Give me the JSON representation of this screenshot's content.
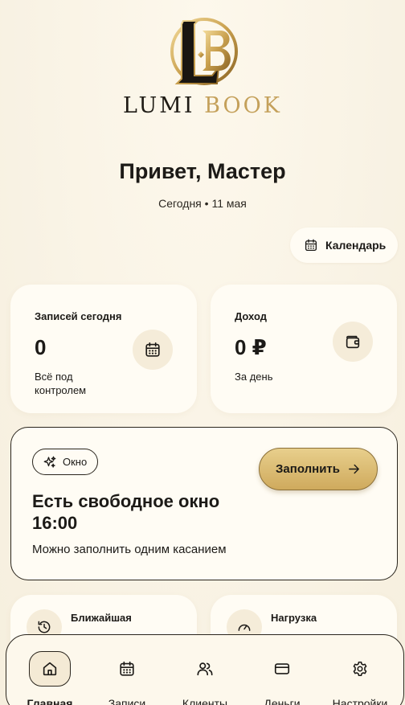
{
  "brand": {
    "logo_text_1": "LUMI",
    "logo_text_2": "BOOK",
    "logo_icon": "lb-monogram-icon",
    "accent_color": "#c4a05a"
  },
  "header": {
    "greeting": "Привет, Мастер",
    "date_line": "Сегодня • 11 мая"
  },
  "calendar_button": {
    "label": "Календарь",
    "icon": "calendar-icon"
  },
  "stats": [
    {
      "title": "Записей сегодня",
      "value": "0",
      "sub": "Всё под контролем",
      "icon": "calendar-icon"
    },
    {
      "title": "Доход",
      "value": "0 ₽",
      "sub": "За день",
      "icon": "wallet-icon"
    }
  ],
  "window_card": {
    "chip_label": "Окно",
    "chip_icon": "sparkles-icon",
    "title": "Есть свободное окно 16:00",
    "subtitle": "Можно заполнить одним касанием",
    "button_label": "Заполнить",
    "button_icon": "arrow-right-icon"
  },
  "mini_cards": [
    {
      "title": "Ближайшая",
      "icon": "history-icon"
    },
    {
      "title": "Нагрузка",
      "icon": "gauge-icon"
    }
  ],
  "nav": {
    "items": [
      {
        "label": "Главная",
        "icon": "home-icon",
        "active": true
      },
      {
        "label": "Записи",
        "icon": "calendar-icon",
        "active": false
      },
      {
        "label": "Клиенты",
        "icon": "users-icon",
        "active": false
      },
      {
        "label": "Деньги",
        "icon": "credit-card-icon",
        "active": false
      },
      {
        "label": "Настройки",
        "icon": "gear-icon",
        "active": false
      }
    ]
  }
}
